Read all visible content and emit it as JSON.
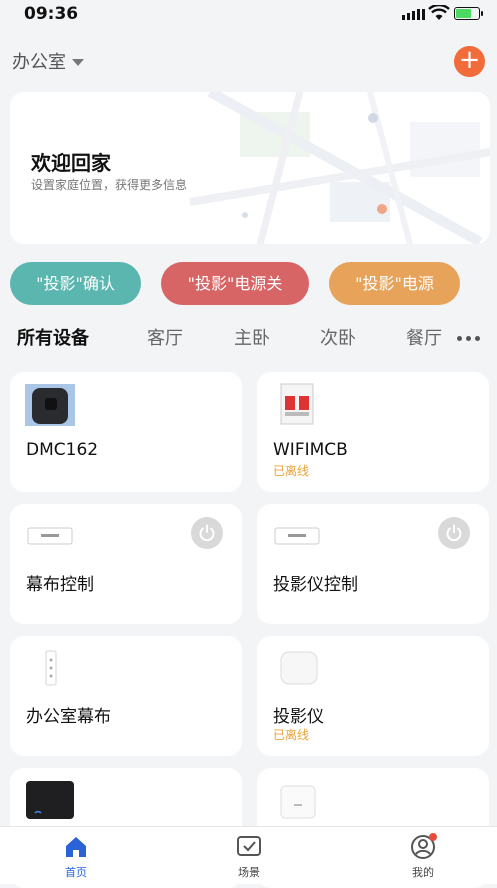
{
  "status_bar": {
    "time": "09:36"
  },
  "header": {
    "home_name": "办公室",
    "add_label": "+"
  },
  "welcome": {
    "title": "欢迎回家",
    "subtitle": "设置家庭位置，获得更多信息"
  },
  "scenes": [
    {
      "label": "\"投影\"确认",
      "color": "#5bb6b0"
    },
    {
      "label": "\"投影\"电源关",
      "color": "#d86565"
    },
    {
      "label": "\"投影\"电源",
      "color": "#e8a35a"
    }
  ],
  "tabs": [
    "所有设备",
    "客厅",
    "主卧",
    "次卧",
    "餐厅"
  ],
  "devices": [
    {
      "name": "DMC162",
      "status": ""
    },
    {
      "name": "WIFIMCB",
      "status": "已离线"
    },
    {
      "name": "幕布控制",
      "status": ""
    },
    {
      "name": "投影仪控制",
      "status": ""
    },
    {
      "name": "办公室幕布",
      "status": ""
    },
    {
      "name": "投影仪",
      "status": "已离线"
    },
    {
      "name": "",
      "status": ""
    },
    {
      "name": "",
      "status": ""
    }
  ],
  "bottom_nav": [
    {
      "label": "首页",
      "icon": "home-icon"
    },
    {
      "label": "场景",
      "icon": "scene-check-icon"
    },
    {
      "label": "我的",
      "icon": "profile-icon"
    }
  ],
  "colors": {
    "accent": "#f26b3a",
    "nav_active": "#2a63d8",
    "offline": "#e8a23a"
  }
}
